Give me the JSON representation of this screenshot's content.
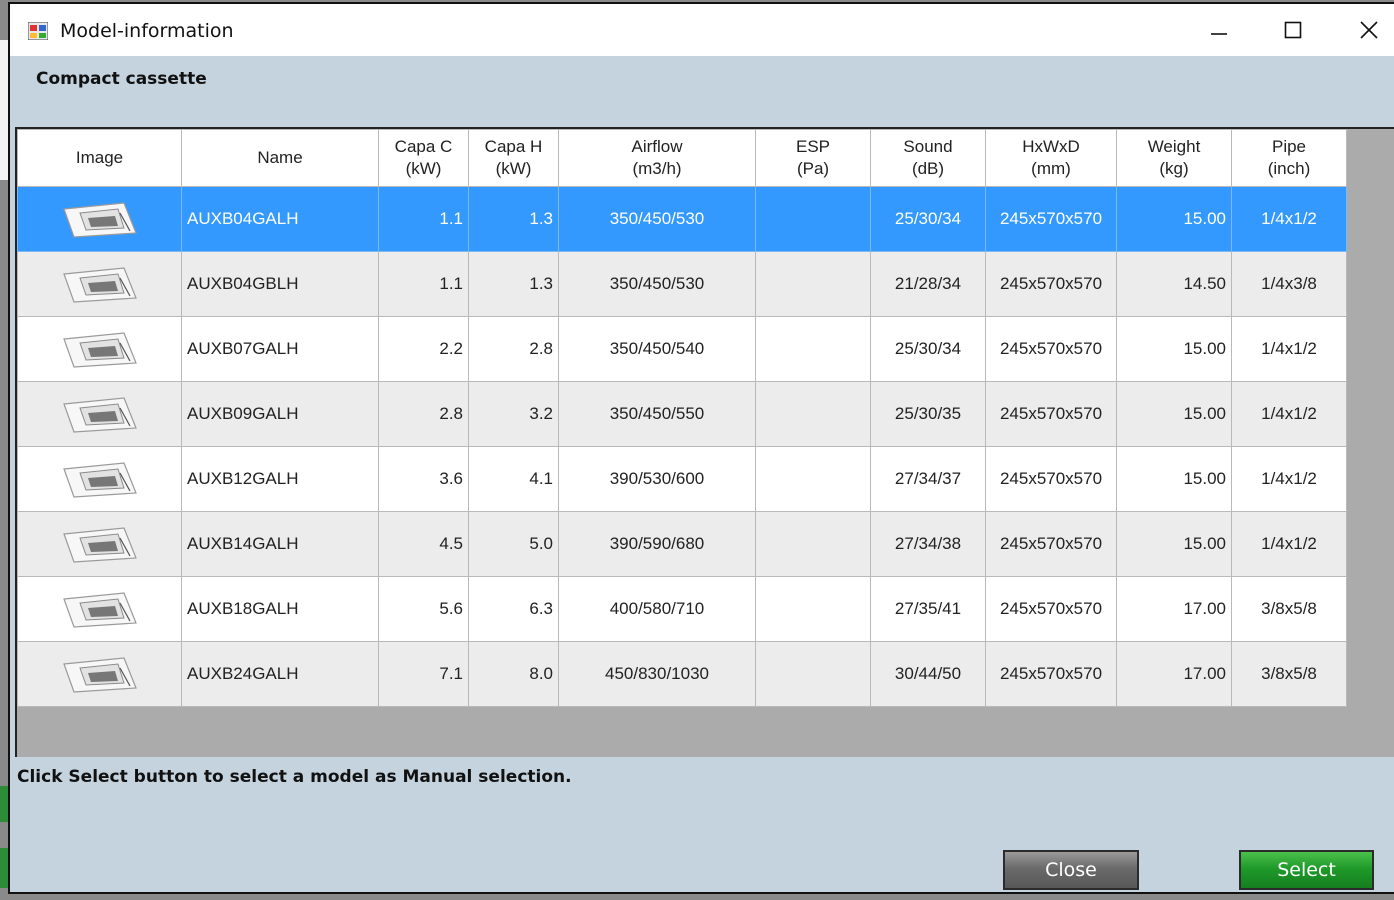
{
  "window": {
    "title": "Model-information",
    "controls": {
      "minimize": "minimize",
      "maximize": "maximize",
      "close": "close"
    }
  },
  "subtitle": "Compact cassette",
  "columns": [
    {
      "line1": "Image",
      "line2": ""
    },
    {
      "line1": "Name",
      "line2": ""
    },
    {
      "line1": "Capa C",
      "line2": "(kW)"
    },
    {
      "line1": "Capa H",
      "line2": "(kW)"
    },
    {
      "line1": "Airflow",
      "line2": "(m3/h)"
    },
    {
      "line1": "ESP",
      "line2": "(Pa)"
    },
    {
      "line1": "Sound",
      "line2": "(dB)"
    },
    {
      "line1": "HxWxD",
      "line2": "(mm)"
    },
    {
      "line1": "Weight",
      "line2": "(kg)"
    },
    {
      "line1": "Pipe",
      "line2": "(inch)"
    }
  ],
  "rows": [
    {
      "name": "AUXB04GALH",
      "capa_c": "1.1",
      "capa_h": "1.3",
      "airflow": "350/450/530",
      "esp": "",
      "sound": "25/30/34",
      "dims": "245x570x570",
      "weight": "15.00",
      "pipe": "1/4x1/2",
      "selected": true
    },
    {
      "name": "AUXB04GBLH",
      "capa_c": "1.1",
      "capa_h": "1.3",
      "airflow": "350/450/530",
      "esp": "",
      "sound": "21/28/34",
      "dims": "245x570x570",
      "weight": "14.50",
      "pipe": "1/4x3/8",
      "selected": false
    },
    {
      "name": "AUXB07GALH",
      "capa_c": "2.2",
      "capa_h": "2.8",
      "airflow": "350/450/540",
      "esp": "",
      "sound": "25/30/34",
      "dims": "245x570x570",
      "weight": "15.00",
      "pipe": "1/4x1/2",
      "selected": false
    },
    {
      "name": "AUXB09GALH",
      "capa_c": "2.8",
      "capa_h": "3.2",
      "airflow": "350/450/550",
      "esp": "",
      "sound": "25/30/35",
      "dims": "245x570x570",
      "weight": "15.00",
      "pipe": "1/4x1/2",
      "selected": false
    },
    {
      "name": "AUXB12GALH",
      "capa_c": "3.6",
      "capa_h": "4.1",
      "airflow": "390/530/600",
      "esp": "",
      "sound": "27/34/37",
      "dims": "245x570x570",
      "weight": "15.00",
      "pipe": "1/4x1/2",
      "selected": false
    },
    {
      "name": "AUXB14GALH",
      "capa_c": "4.5",
      "capa_h": "5.0",
      "airflow": "390/590/680",
      "esp": "",
      "sound": "27/34/38",
      "dims": "245x570x570",
      "weight": "15.00",
      "pipe": "1/4x1/2",
      "selected": false
    },
    {
      "name": "AUXB18GALH",
      "capa_c": "5.6",
      "capa_h": "6.3",
      "airflow": "400/580/710",
      "esp": "",
      "sound": "27/35/41",
      "dims": "245x570x570",
      "weight": "17.00",
      "pipe": "3/8x5/8",
      "selected": false
    },
    {
      "name": "AUXB24GALH",
      "capa_c": "7.1",
      "capa_h": "8.0",
      "airflow": "450/830/1030",
      "esp": "",
      "sound": "30/44/50",
      "dims": "245x570x570",
      "weight": "17.00",
      "pipe": "3/8x5/8",
      "selected": false
    }
  ],
  "row_icon": "cassette-unit-icon",
  "hint": "Click Select button to select a model as Manual selection.",
  "buttons": {
    "close": "Close",
    "select": "Select"
  },
  "colors": {
    "selected_row": "#3399ff",
    "dialog_bg": "#c5d3df",
    "select_button": "#1f9a2a",
    "close_button": "#6a6a6a"
  }
}
